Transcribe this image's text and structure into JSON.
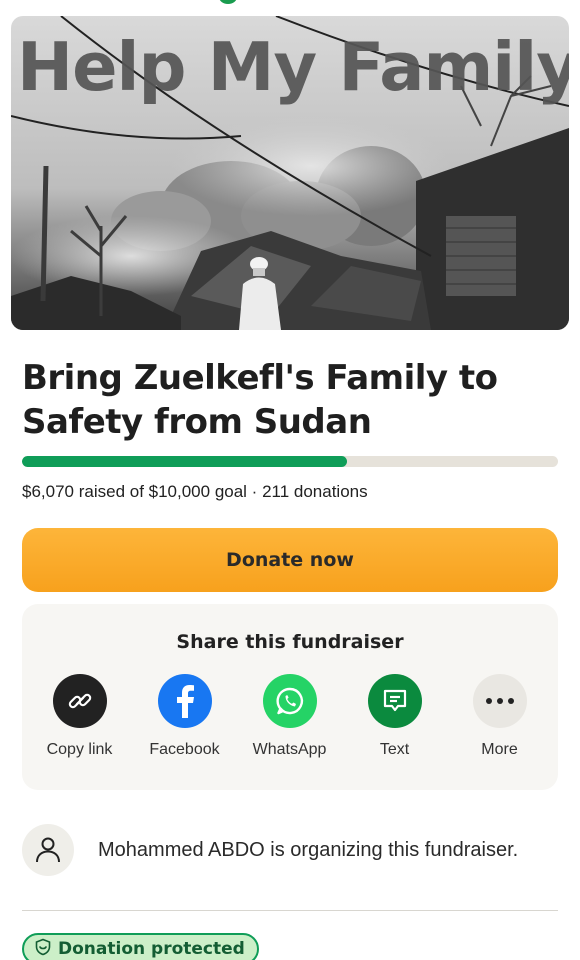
{
  "hero": {
    "overlay_text": "Help My Family",
    "image_description_icon": "burned-village-photo"
  },
  "campaign": {
    "title": "Bring Zuelkefl's Family to Safety from Sudan",
    "raised": "$6,070",
    "goal": "$10,000",
    "donations": "211",
    "raised_line": "$6,070 raised of $10,000 goal · 211 donations",
    "progress_fraction": 0.607
  },
  "donate": {
    "label": "Donate now"
  },
  "share": {
    "title": "Share this fundraiser",
    "items": [
      {
        "label": "Copy link",
        "icon": "link-icon",
        "color": "#222222"
      },
      {
        "label": "Facebook",
        "icon": "facebook-icon",
        "color": "#1877f2"
      },
      {
        "label": "WhatsApp",
        "icon": "whatsapp-icon",
        "color": "#25d366"
      },
      {
        "label": "Text",
        "icon": "text-message-icon",
        "color": "#0b8a3e"
      },
      {
        "label": "More",
        "icon": "more-icon",
        "color": "#e9e7e2"
      }
    ]
  },
  "organizer": {
    "text": "Mohammed ABDO is organizing this fundraiser."
  },
  "protection": {
    "label": "Donation protected"
  },
  "colors": {
    "accent_green": "#0f9d58",
    "donate_orange": "#f9a825"
  }
}
